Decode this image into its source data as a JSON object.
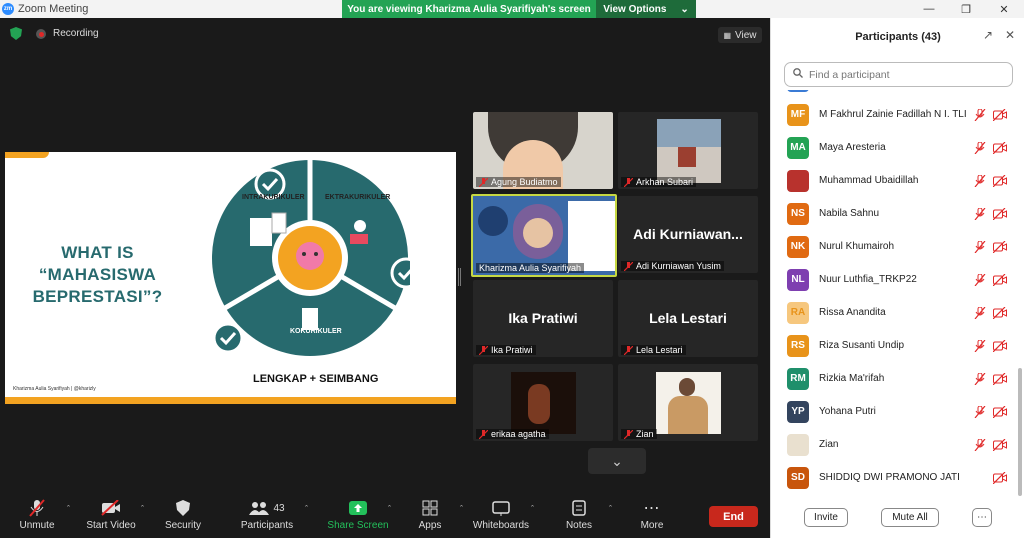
{
  "window": {
    "title": "Zoom Meeting",
    "logo_text": "zm"
  },
  "banner": {
    "message": "You are viewing Kharizma Aulia Syarifiyah's screen",
    "options_label": "View Options"
  },
  "status": {
    "recording_label": "Recording",
    "view_label": "View"
  },
  "slide": {
    "title_lines": [
      "WHAT IS",
      "“MAHASISWA",
      "BEPRESTASI”?"
    ],
    "segments": {
      "intra": "INTRAKURIKULER",
      "ekstra": "EKTRAKURIKULER",
      "ko": "KOKURIKULER"
    },
    "bottom_text": "LENGKAP + SEIMBANG",
    "credit": "Kharizma Aulia Syarifiyah | @kharizly",
    "colors": {
      "teal": "#276a6e",
      "accent": "#f3a321"
    }
  },
  "videos": [
    {
      "name": "Agung Budiatmo",
      "type": "camera-person",
      "muted": true
    },
    {
      "name": "Arkhan Subari",
      "type": "camera-building",
      "muted": true
    },
    {
      "name": "Kharizma Aulia Syarifiyah",
      "type": "camera-active-speaker",
      "muted": false,
      "active": true
    },
    {
      "name": "Adi Kurniawan Yusim",
      "display": "Adi  Kurniawan...",
      "type": "name-only",
      "muted": true
    },
    {
      "name": "Ika Pratiwi",
      "display": "Ika Pratiwi",
      "type": "name-only",
      "muted": true
    },
    {
      "name": "Lela Lestari",
      "display": "Lela Lestari",
      "type": "name-only",
      "muted": true
    },
    {
      "name": "erikaa agatha",
      "type": "camera-dark",
      "muted": true
    },
    {
      "name": "Zian",
      "type": "camera-photo",
      "muted": true
    }
  ],
  "toolbar": {
    "unmute": "Unmute",
    "start_video": "Start Video",
    "security": "Security",
    "participants": "Participants",
    "participants_count": "43",
    "share_screen": "Share Screen",
    "apps": "Apps",
    "whiteboards": "Whiteboards",
    "notes": "Notes",
    "more": "More",
    "end": "End"
  },
  "participants_panel": {
    "title": "Participants (43)",
    "search_placeholder": "Find a participant",
    "items": [
      {
        "initials": "MF",
        "name": "M Fakhrul Zainie Fadillah N I. TLI",
        "color": "#e8931a",
        "video_off": true
      },
      {
        "initials": "MA",
        "name": "Maya Aresteria",
        "color": "#23a354",
        "video_off": true
      },
      {
        "initials": "",
        "name": "Muhammad Ubaidillah",
        "color": "#b8322d",
        "photo": true,
        "video_off": true
      },
      {
        "initials": "NS",
        "name": "Nabila Sahnu",
        "color": "#e06a12",
        "video_off": true
      },
      {
        "initials": "NK",
        "name": "Nurul Khumairoh",
        "color": "#e06a12",
        "video_off": true
      },
      {
        "initials": "NL",
        "name": "Nuur Luthfia_TRKP22",
        "color": "#7e3fb0",
        "video_off": true
      },
      {
        "initials": "RA",
        "name": "Rissa Anandita",
        "color": "#f6c77e",
        "text_color": "#e8931a",
        "video_off": true
      },
      {
        "initials": "RS",
        "name": "Riza Susanti Undip",
        "color": "#e8931a",
        "video_off": true
      },
      {
        "initials": "RM",
        "name": "Rizkia Ma'rifah",
        "color": "#1f8f6b",
        "video_off": true
      },
      {
        "initials": "YP",
        "name": "Yohana Putri",
        "color": "#33445e",
        "video_off": true
      },
      {
        "initials": "",
        "name": "Zian",
        "color": "#e9e0cf",
        "photo": true,
        "video_off": true
      },
      {
        "initials": "SD",
        "name": "SHIDDIQ DWI PRAMONO JATI",
        "color": "#c8550c",
        "video_off": true
      }
    ],
    "invite": "Invite",
    "mute_all": "Mute All",
    "more_label": "⋯"
  }
}
